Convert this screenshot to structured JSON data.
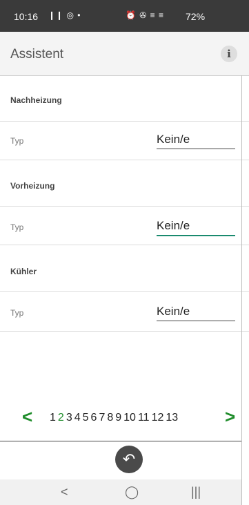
{
  "status_bar": {
    "time": "10:16",
    "left_icons": "❙❙ ◎ •",
    "right_icons": "⏰ ✇ ≡ ≡",
    "battery": "72%"
  },
  "header": {
    "title": "Assistent",
    "info_icon": "i"
  },
  "sections": [
    {
      "title": "Nachheizung",
      "row_label": "Typ",
      "value": "Kein/e"
    },
    {
      "title": "Vorheizung",
      "row_label": "Typ",
      "value": "Kein/e"
    },
    {
      "title": "Kühler",
      "row_label": "Typ",
      "value": "Kein/e"
    }
  ],
  "pager": {
    "prev": "<",
    "next": ">",
    "pages": [
      "1",
      "2",
      "3",
      "4",
      "5",
      "6",
      "7",
      "8",
      "9",
      "10",
      "11",
      "12",
      "13"
    ],
    "current_index": 1
  },
  "bottom": {
    "back_glyph": "↶"
  },
  "nav_bar": {
    "back": "<",
    "home": "◯",
    "recents": "|||"
  },
  "colors": {
    "accent_green": "#1e8c2a",
    "focus_teal": "#1a8a6e",
    "status_bg": "#3a3a3a"
  }
}
